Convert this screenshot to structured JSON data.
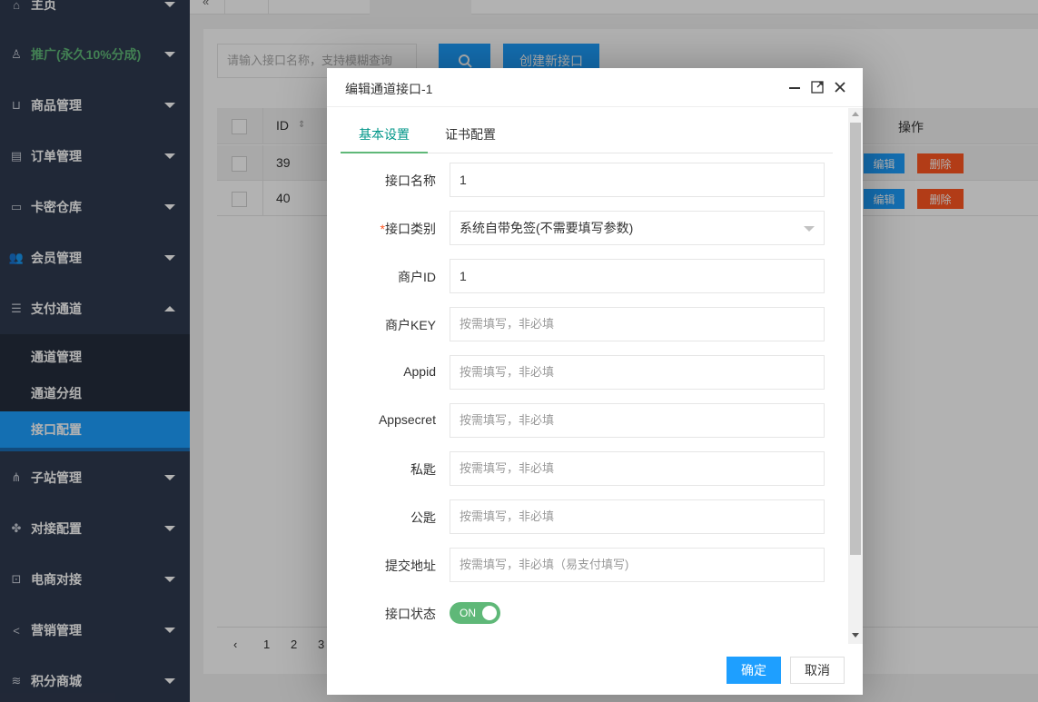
{
  "sidebar": {
    "items": [
      {
        "label": "主页",
        "icon": "home-icon"
      },
      {
        "label": "推广(永久10%分成)",
        "icon": "sitemap-icon",
        "color": "#5fb878"
      },
      {
        "label": "商品管理",
        "icon": "cart-icon"
      },
      {
        "label": "订单管理",
        "icon": "clipboard-icon"
      },
      {
        "label": "卡密仓库",
        "icon": "card-icon"
      },
      {
        "label": "会员管理",
        "icon": "users-icon"
      },
      {
        "label": "支付通道",
        "icon": "list-icon"
      },
      {
        "label": "子站管理",
        "icon": "tree-icon"
      },
      {
        "label": "对接配置",
        "icon": "puzzle-icon"
      },
      {
        "label": "电商对接",
        "icon": "lock-bag-icon"
      },
      {
        "label": "营销管理",
        "icon": "share-icon"
      },
      {
        "label": "积分商城",
        "icon": "coins-icon"
      }
    ],
    "sub_items": [
      {
        "label": "通道管理"
      },
      {
        "label": "通道分组"
      },
      {
        "label": "接口配置"
      }
    ]
  },
  "toolbar": {
    "search_placeholder": "请输入接口名称，支持模糊查询",
    "create_label": "创建新接口"
  },
  "table": {
    "headers": {
      "id": "ID",
      "ops": "操作"
    },
    "rows": [
      {
        "id": "39"
      },
      {
        "id": "40"
      }
    ],
    "edit_label": "编辑",
    "delete_label": "删除"
  },
  "pager": {
    "pages": [
      "1",
      "2",
      "3"
    ]
  },
  "modal": {
    "title": "编辑通道接口-1",
    "tabs": [
      "基本设置",
      "证书配置"
    ],
    "fields": {
      "name": {
        "label": "接口名称",
        "value": "1"
      },
      "type": {
        "label": "接口类别",
        "required": "*",
        "value": "系统自带免签(不需要填写参数)"
      },
      "merchant_id": {
        "label": "商户ID",
        "value": "1"
      },
      "merchant_key": {
        "label": "商户KEY",
        "placeholder": "按需填写，非必填"
      },
      "appid": {
        "label": "Appid",
        "placeholder": "按需填写，非必填"
      },
      "appsecret": {
        "label": "Appsecret",
        "placeholder": "按需填写，非必填"
      },
      "private_key": {
        "label": "私匙",
        "placeholder": "按需填写，非必填"
      },
      "public_key": {
        "label": "公匙",
        "placeholder": "按需填写，非必填"
      },
      "submit_url": {
        "label": "提交地址",
        "placeholder": "按需填写，非必填（易支付填写)"
      },
      "status": {
        "label": "接口状态",
        "value": "ON"
      }
    },
    "ok_label": "确定",
    "cancel_label": "取消"
  },
  "colors": {
    "sidebar_bg": "#2f3a4f",
    "accent": "#1e9fff",
    "switch_on": "#5fb878",
    "danger": "#ff5722",
    "tab_active": "#009688"
  }
}
